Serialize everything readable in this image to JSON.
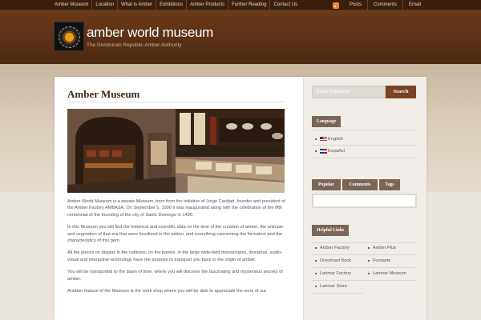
{
  "topnav": {
    "items": [
      "Amber Museum",
      "Location",
      "What is Amber",
      "Exhibitions",
      "Amber Products",
      "Further Reading",
      "Contact Us"
    ]
  },
  "toplinks": {
    "posts": "Posts",
    "comments": "Comments",
    "email": "Email"
  },
  "header": {
    "title": "amber world museum",
    "tagline": "The Dominican Republic Amber Authority"
  },
  "content": {
    "title": "Amber Museum",
    "paragraphs": [
      "Amber World Museum is a private Museum, born from the initiative of Jorge Caridad, founder and president of the Amber Factory AMBASA. On September 5, 1996 it was inaugurated along with the celebration of the fifth centennial of the founding of the city of Santo Domingo in 1496.",
      "In this Museum you will find the historical and scientific data on the time of the creation of amber, the animals and vegetation of that era that were fossilized in the amber, and everything concerning the formation and the characteristics of this gem.",
      "All the pieces on display in the cabinets, on the panels, in the large wide-field microscopes, dioramas, audio-visual and interactive technology have the purpose to transport you back to the origin of amber.",
      "You will be transported to the dawn of time, where you will discover the fascinating and mysterious secrets of amber.",
      "Another feature of the Museum is the work shop where you will be able to appreciate the work of our"
    ]
  },
  "sidebar": {
    "search": {
      "placeholder": "Enter keywords",
      "button": "Search"
    },
    "language": {
      "title": "Language",
      "items": [
        "English",
        "Español"
      ]
    },
    "tabs": [
      "Popular",
      "Comments",
      "Tags"
    ],
    "helpful_links": {
      "title": "Helpful Links",
      "left": [
        "Amber Factory",
        "Download Book",
        "Larimar Factory",
        "Larimar Store"
      ],
      "right": [
        "Amber Plus",
        "Fundarte",
        "Larimar Museum"
      ]
    }
  },
  "colors": {
    "topbar": "#3a1f0e",
    "header": "#5a3014",
    "accent": "#7a4424",
    "widget": "#7a6556"
  }
}
